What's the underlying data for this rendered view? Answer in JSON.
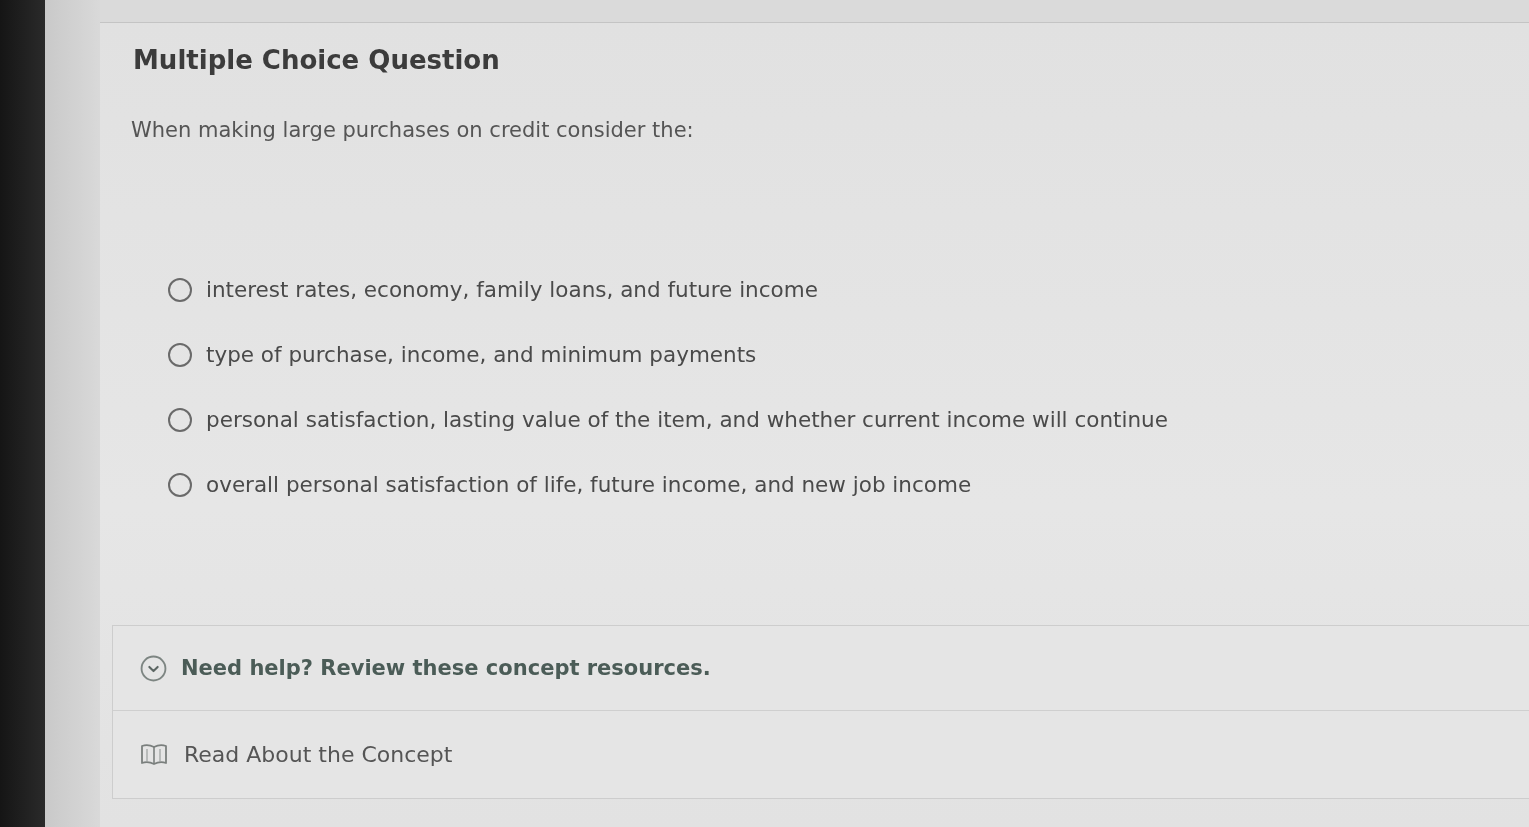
{
  "question": {
    "heading": "Multiple Choice Question",
    "prompt": "When making large purchases on credit consider the:",
    "options": [
      {
        "label": "interest rates, economy, family loans, and future income",
        "selected": false
      },
      {
        "label": "type of purchase, income, and minimum payments",
        "selected": false
      },
      {
        "label": "personal satisfaction, lasting value of the item, and whether current income will continue",
        "selected": false
      },
      {
        "label": "overall personal satisfaction of life, future income, and new job income",
        "selected": false
      }
    ]
  },
  "help": {
    "toggle": {
      "label": "Need help? Review these concept resources.",
      "expanded": true
    },
    "resources": [
      {
        "label": "Read About the Concept"
      }
    ]
  }
}
